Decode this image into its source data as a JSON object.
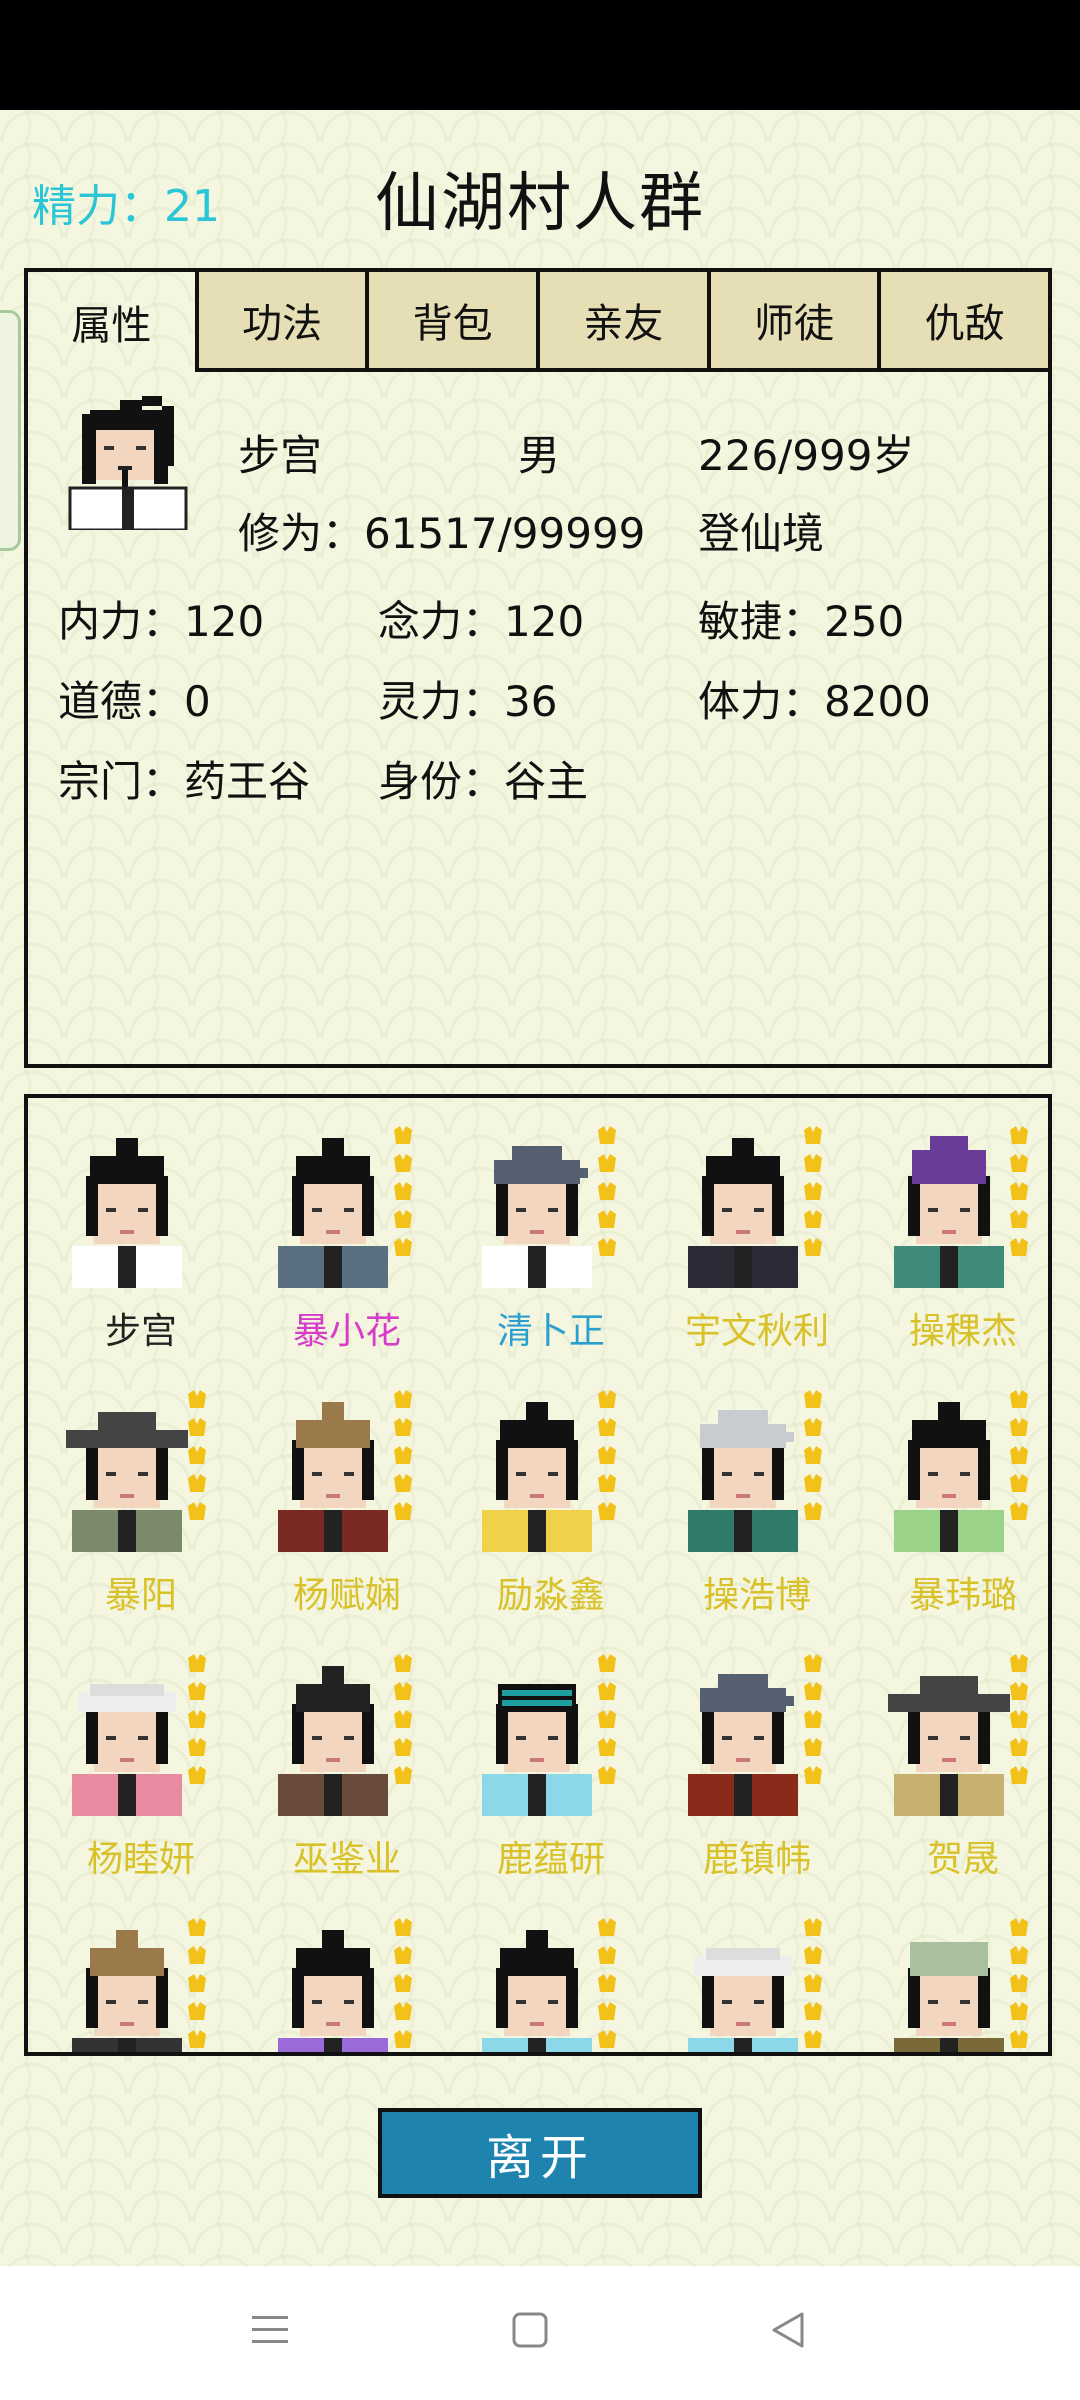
{
  "header": {
    "energy_label": "精力：",
    "energy_value": "21",
    "title": "仙湖村人群"
  },
  "tabs": [
    "属性",
    "功法",
    "背包",
    "亲友",
    "师徒",
    "仇敌"
  ],
  "profile": {
    "name": "步宫",
    "gender": "男",
    "age": "226/999岁",
    "cultivation_label": "修为：",
    "cultivation_value": "61517/99999",
    "realm": "登仙境",
    "stats": [
      {
        "label": "内力：",
        "value": "120"
      },
      {
        "label": "念力：",
        "value": "120"
      },
      {
        "label": "敏捷：",
        "value": "250"
      },
      {
        "label": "道德：",
        "value": "0"
      },
      {
        "label": "灵力：",
        "value": "36"
      },
      {
        "label": "体力：",
        "value": "8200"
      },
      {
        "label": "宗门：",
        "value": "药王谷"
      },
      {
        "label": "身份：",
        "value": "谷主"
      }
    ]
  },
  "roster": [
    {
      "name": "步宫",
      "color": "#222222",
      "hat": "topknot",
      "robe": "#ffffff",
      "badges": 0
    },
    {
      "name": "暴小花",
      "color": "#d63bc9",
      "hat": "bun",
      "robe": "#5a6f7f",
      "badges": 5
    },
    {
      "name": "清卜正",
      "color": "#2a9fd0",
      "hat": "scholar",
      "robe": "#ffffff",
      "badges": 5
    },
    {
      "name": "宇文秋利",
      "color": "#d9c12a",
      "hat": "topknot",
      "robe": "#2b2b38",
      "badges": 5
    },
    {
      "name": "操稞杰",
      "color": "#d9c12a",
      "hat": "purple",
      "robe": "#3f8a7a",
      "badges": 5
    },
    {
      "name": "暴阳",
      "color": "#d9c12a",
      "hat": "straw",
      "robe": "#7a8a6a",
      "badges": 5
    },
    {
      "name": "杨赋娴",
      "color": "#d9c12a",
      "hat": "crown",
      "robe": "#7a2a22",
      "badges": 5
    },
    {
      "name": "励淼鑫",
      "color": "#d9c12a",
      "hat": "bun",
      "robe": "#f0d24a",
      "badges": 5
    },
    {
      "name": "操浩博",
      "color": "#d9c12a",
      "hat": "grey",
      "robe": "#2f7a6a",
      "badges": 5
    },
    {
      "name": "暴玮璐",
      "color": "#d9c12a",
      "hat": "bun",
      "robe": "#9ad28a",
      "badges": 5
    },
    {
      "name": "杨睦妍",
      "color": "#d9c12a",
      "hat": "white",
      "robe": "#e88aa0",
      "badges": 5
    },
    {
      "name": "巫鉴业",
      "color": "#d9c12a",
      "hat": "spike",
      "robe": "#6a4a3a",
      "badges": 5
    },
    {
      "name": "鹿蕴研",
      "color": "#d9c12a",
      "hat": "teal",
      "robe": "#8ad8e8",
      "badges": 5
    },
    {
      "name": "鹿镇帏",
      "color": "#d9c12a",
      "hat": "scholar",
      "robe": "#8a2a1a",
      "badges": 5
    },
    {
      "name": "贺晟",
      "color": "#d9c12a",
      "hat": "straw",
      "robe": "#c8b070",
      "badges": 5
    },
    {
      "name": "",
      "color": "#d9c12a",
      "hat": "crown",
      "robe": "#333333",
      "badges": 5
    },
    {
      "name": "",
      "color": "#d9c12a",
      "hat": "bun",
      "robe": "#9a6ad8",
      "badges": 5
    },
    {
      "name": "",
      "color": "#d9c12a",
      "hat": "bun",
      "robe": "#8ad8e8",
      "badges": 5
    },
    {
      "name": "",
      "color": "#d9c12a",
      "hat": "white",
      "robe": "#8ad8e8",
      "badges": 5
    },
    {
      "name": "",
      "color": "#d9c12a",
      "hat": "green",
      "robe": "#7a6a3a",
      "badges": 5
    }
  ],
  "buttons": {
    "leave": "离开"
  },
  "nav_icons": [
    "menu-icon",
    "home-square-icon",
    "back-triangle-icon"
  ]
}
